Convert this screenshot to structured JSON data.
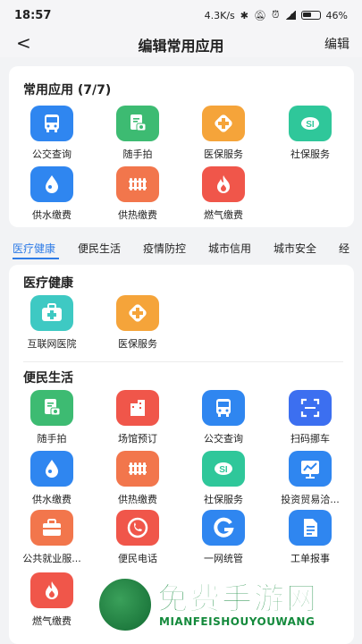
{
  "status_bar": {
    "time": "18:57",
    "net_speed": "4.3K/s",
    "battery": "46"
  },
  "nav": {
    "back": "<",
    "title": "编辑常用应用",
    "edit": "编辑"
  },
  "common": {
    "title": "常用应用 (7/7)",
    "apps": [
      {
        "label": "公交查询",
        "icon": "bus-icon",
        "color": "#2f86f0"
      },
      {
        "label": "随手拍",
        "icon": "camera-clipboard-icon",
        "color": "#3dbb72"
      },
      {
        "label": "医保服务",
        "icon": "medical-plus-icon",
        "color": "#f5a43a"
      },
      {
        "label": "社保服务",
        "icon": "social-security-icon",
        "color": "#2fc79a"
      },
      {
        "label": "供水缴费",
        "icon": "water-drop-icon",
        "color": "#2f86f0"
      },
      {
        "label": "供热缴费",
        "icon": "radiator-icon",
        "color": "#f2764c"
      },
      {
        "label": "燃气缴费",
        "icon": "flame-icon",
        "color": "#f0564a"
      }
    ]
  },
  "tabs": [
    "医疗健康",
    "便民生活",
    "疫情防控",
    "城市信用",
    "城市安全",
    "经"
  ],
  "sections": {
    "health": {
      "title": "医疗健康",
      "apps": [
        {
          "label": "互联网医院",
          "icon": "medical-kit-icon",
          "color": "#3ec9c3"
        },
        {
          "label": "医保服务",
          "icon": "medical-plus-icon",
          "color": "#f5a43a"
        }
      ]
    },
    "life": {
      "title": "便民生活",
      "apps": [
        {
          "label": "随手拍",
          "icon": "camera-clipboard-icon",
          "color": "#3dbb72"
        },
        {
          "label": "场馆预订",
          "icon": "building-icon",
          "color": "#f0564a"
        },
        {
          "label": "公交查询",
          "icon": "bus-icon",
          "color": "#2f86f0"
        },
        {
          "label": "扫码挪车",
          "icon": "scan-icon",
          "color": "#3c6ff0"
        },
        {
          "label": "供水缴费",
          "icon": "water-drop-icon",
          "color": "#2f86f0"
        },
        {
          "label": "供热缴费",
          "icon": "radiator-icon",
          "color": "#f2764c"
        },
        {
          "label": "社保服务",
          "icon": "social-security-icon",
          "color": "#2fc79a"
        },
        {
          "label": "投资贸易洽...",
          "icon": "chart-board-icon",
          "color": "#2f86f0"
        },
        {
          "label": "公共就业服...",
          "icon": "briefcase-icon",
          "color": "#f2764c"
        },
        {
          "label": "便民电话",
          "icon": "phone-icon",
          "color": "#f0564a"
        },
        {
          "label": "一网统管",
          "icon": "g-logo-icon",
          "color": "#2f86f0"
        },
        {
          "label": "工单报事",
          "icon": "document-icon",
          "color": "#2f86f0"
        },
        {
          "label": "燃气缴费",
          "icon": "flame-icon",
          "color": "#f0564a"
        }
      ]
    }
  },
  "watermark": {
    "title": "免费手游网",
    "subtitle": "MIANFEISHOUYOUWANG"
  }
}
